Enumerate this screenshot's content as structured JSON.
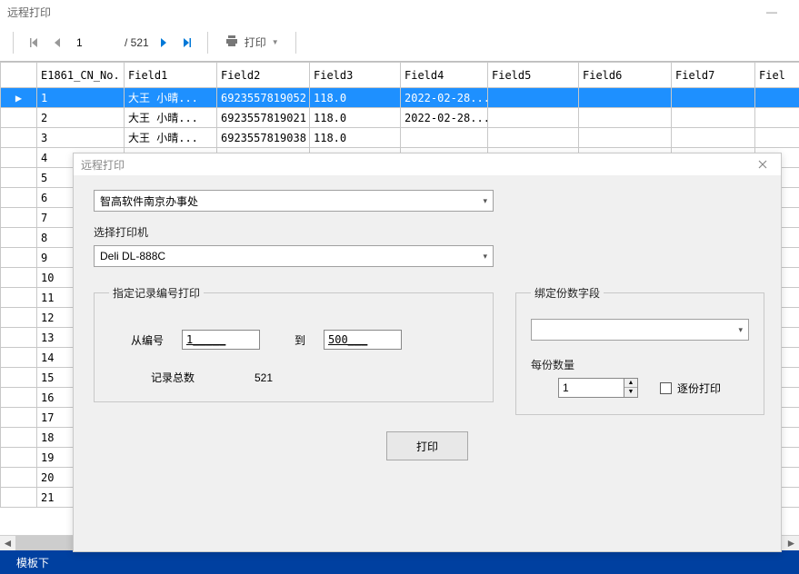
{
  "window": {
    "title": "远程打印",
    "minimize": "—"
  },
  "toolbar": {
    "page_value": "1",
    "page_total": "/ 521",
    "print_label": "打印"
  },
  "grid": {
    "headers": [
      "E1861_CN_No.",
      "Field1",
      "Field2",
      "Field3",
      "Field4",
      "Field5",
      "Field6",
      "Field7",
      "Fiel"
    ],
    "rows": [
      {
        "n": "1",
        "f1": "大王 小晴...",
        "f2": "6923557819052",
        "f3": "118.0",
        "f4": "2022-02-28...",
        "selected": true
      },
      {
        "n": "2",
        "f1": "大王 小晴...",
        "f2": "6923557819021",
        "f3": "118.0",
        "f4": "2022-02-28..."
      },
      {
        "n": "3",
        "f1": "大王 小晴...",
        "f2": "6923557819038",
        "f3": "118.0",
        "f4": ""
      },
      {
        "n": "4"
      },
      {
        "n": "5"
      },
      {
        "n": "6"
      },
      {
        "n": "7"
      },
      {
        "n": "8"
      },
      {
        "n": "9"
      },
      {
        "n": "10"
      },
      {
        "n": "11"
      },
      {
        "n": "12"
      },
      {
        "n": "13"
      },
      {
        "n": "14"
      },
      {
        "n": "15"
      },
      {
        "n": "16"
      },
      {
        "n": "17"
      },
      {
        "n": "18"
      },
      {
        "n": "19"
      },
      {
        "n": "20"
      },
      {
        "n": "21"
      }
    ]
  },
  "bottom": {
    "template_dl": "模板下"
  },
  "dialog": {
    "title": "远程打印",
    "location": "智高软件南京办事处",
    "printer_label": "选择打印机",
    "printer": "Deli DL-888C",
    "range_legend": "指定记录编号打印",
    "from_label": "从编号",
    "from_value": "1_____",
    "to_label": "到",
    "to_value": "500___",
    "total_label": "记录总数",
    "total_value": "521",
    "bind_legend": "绑定份数字段",
    "bind_value": "",
    "copies_label": "每份数量",
    "copies_value": "1",
    "collate_label": "逐份打印",
    "submit": "打印"
  }
}
